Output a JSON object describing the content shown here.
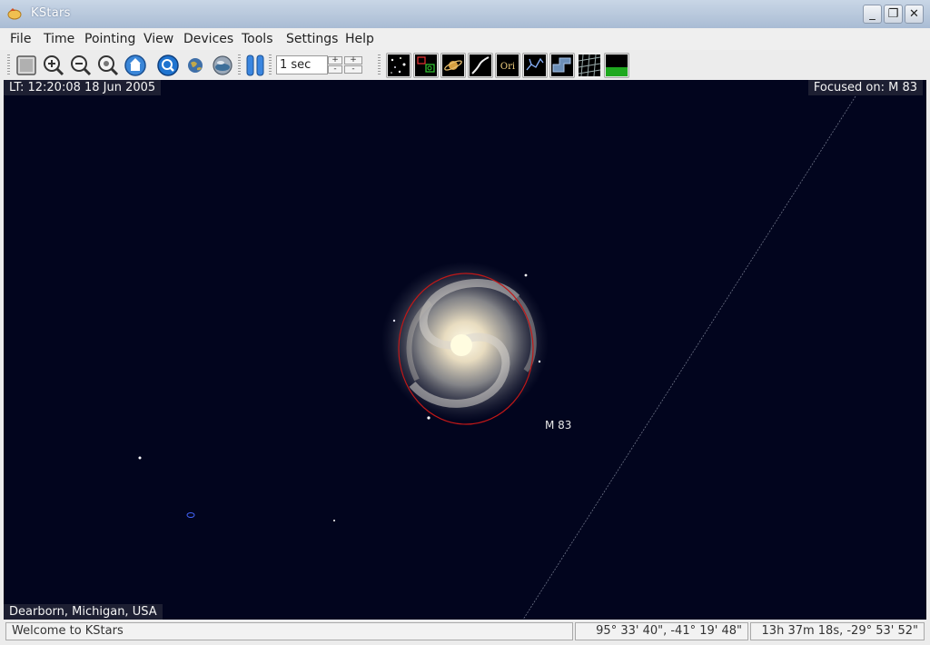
{
  "window": {
    "title": "KStars"
  },
  "menu": [
    "File",
    "Time",
    "Pointing",
    "View",
    "Devices",
    "Tools",
    "Settings",
    "Help"
  ],
  "toolbar": {
    "icons": [
      "stop-icon",
      "zoom-in-icon",
      "zoom-out-icon",
      "zoom-default-icon",
      "zenith-icon",
      "find-object-icon",
      "equatorial-earth-icon",
      "horizontal-globe-icon",
      "pause-icon"
    ],
    "time_step": "1 sec",
    "step_up": "+",
    "step_down": "-",
    "view_icons": [
      "stars-icon",
      "deep-sky-icon",
      "solar-system-icon",
      "milky-way-icon",
      "constellation-names-icon",
      "constellation-lines-icon",
      "constellation-boundaries-icon",
      "coordinate-grid-icon",
      "ground-icon"
    ],
    "constellation_names_text": "Ori"
  },
  "sky": {
    "local_time": "LT: 12:20:08   18 Jun 2005",
    "focus": "Focused on: M 83",
    "object_label": "M 83",
    "location": "Dearborn, Michigan,  USA"
  },
  "status": {
    "message": "Welcome to KStars",
    "altaz": "95° 33' 40\",  -41° 19' 48\"",
    "radec": "13h 37m 18s,  -29° 53' 52\""
  },
  "colors": {
    "sky": "#02051e",
    "focus_circle": "#c01818",
    "titlebar": "#b4c4d9"
  }
}
